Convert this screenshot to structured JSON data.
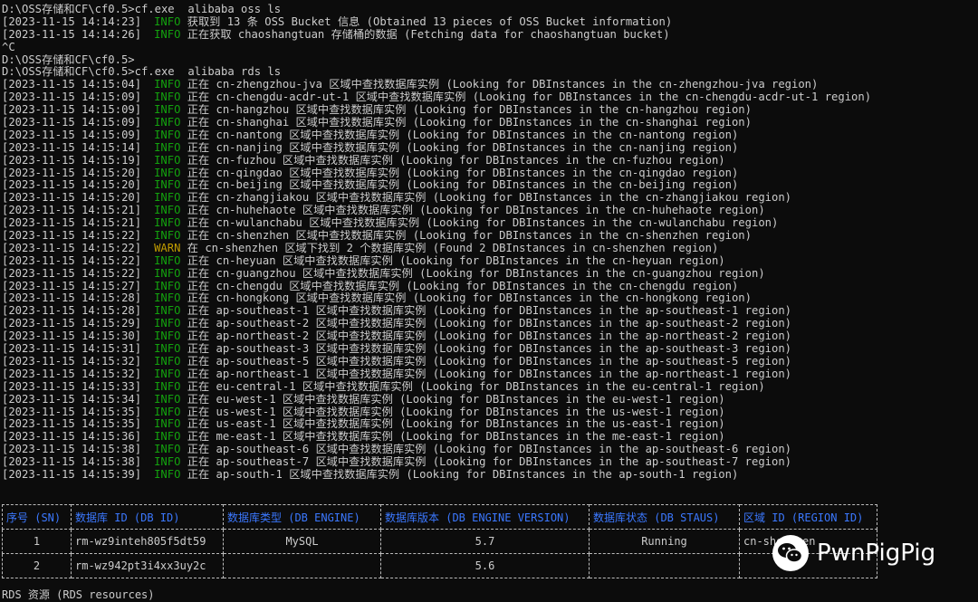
{
  "terminal": {
    "lines": [
      {
        "kind": "cmd",
        "text": "D:\\OSS存储和CF\\cf0.5>cf.exe  alibaba oss ls"
      },
      {
        "kind": "log",
        "ts": "[2023-11-15 14:14:23]",
        "level": "INFO",
        "msg": "获取到 13 条 OSS Bucket 信息 (Obtained 13 pieces of OSS Bucket information)"
      },
      {
        "kind": "log",
        "ts": "[2023-11-15 14:14:26]",
        "level": "INFO",
        "msg": "正在获取 chaoshangtuan 存储桶的数据 (Fetching data for chaoshangtuan bucket)"
      },
      {
        "kind": "cmd",
        "text": "^C"
      },
      {
        "kind": "cmd",
        "text": "D:\\OSS存储和CF\\cf0.5>"
      },
      {
        "kind": "cmd",
        "text": "D:\\OSS存储和CF\\cf0.5>cf.exe  alibaba rds ls"
      },
      {
        "kind": "log",
        "ts": "[2023-11-15 14:15:04]",
        "level": "INFO",
        "msg": "正在 cn-zhengzhou-jva 区域中查找数据库实例 (Looking for DBInstances in the cn-zhengzhou-jva region)"
      },
      {
        "kind": "log",
        "ts": "[2023-11-15 14:15:09]",
        "level": "INFO",
        "msg": "正在 cn-chengdu-acdr-ut-1 区域中查找数据库实例 (Looking for DBInstances in the cn-chengdu-acdr-ut-1 region)"
      },
      {
        "kind": "log",
        "ts": "[2023-11-15 14:15:09]",
        "level": "INFO",
        "msg": "正在 cn-hangzhou 区域中查找数据库实例 (Looking for DBInstances in the cn-hangzhou region)"
      },
      {
        "kind": "log",
        "ts": "[2023-11-15 14:15:09]",
        "level": "INFO",
        "msg": "正在 cn-shanghai 区域中查找数据库实例 (Looking for DBInstances in the cn-shanghai region)"
      },
      {
        "kind": "log",
        "ts": "[2023-11-15 14:15:09]",
        "level": "INFO",
        "msg": "正在 cn-nantong 区域中查找数据库实例 (Looking for DBInstances in the cn-nantong region)"
      },
      {
        "kind": "log",
        "ts": "[2023-11-15 14:15:14]",
        "level": "INFO",
        "msg": "正在 cn-nanjing 区域中查找数据库实例 (Looking for DBInstances in the cn-nanjing region)"
      },
      {
        "kind": "log",
        "ts": "[2023-11-15 14:15:19]",
        "level": "INFO",
        "msg": "正在 cn-fuzhou 区域中查找数据库实例 (Looking for DBInstances in the cn-fuzhou region)"
      },
      {
        "kind": "log",
        "ts": "[2023-11-15 14:15:20]",
        "level": "INFO",
        "msg": "正在 cn-qingdao 区域中查找数据库实例 (Looking for DBInstances in the cn-qingdao region)"
      },
      {
        "kind": "log",
        "ts": "[2023-11-15 14:15:20]",
        "level": "INFO",
        "msg": "正在 cn-beijing 区域中查找数据库实例 (Looking for DBInstances in the cn-beijing region)"
      },
      {
        "kind": "log",
        "ts": "[2023-11-15 14:15:20]",
        "level": "INFO",
        "msg": "正在 cn-zhangjiakou 区域中查找数据库实例 (Looking for DBInstances in the cn-zhangjiakou region)"
      },
      {
        "kind": "log",
        "ts": "[2023-11-15 14:15:21]",
        "level": "INFO",
        "msg": "正在 cn-huhehaote 区域中查找数据库实例 (Looking for DBInstances in the cn-huhehaote region)"
      },
      {
        "kind": "log",
        "ts": "[2023-11-15 14:15:21]",
        "level": "INFO",
        "msg": "正在 cn-wulanchabu 区域中查找数据库实例 (Looking for DBInstances in the cn-wulanchabu region)"
      },
      {
        "kind": "log",
        "ts": "[2023-11-15 14:15:22]",
        "level": "INFO",
        "msg": "正在 cn-shenzhen 区域中查找数据库实例 (Looking for DBInstances in the cn-shenzhen region)"
      },
      {
        "kind": "log",
        "ts": "[2023-11-15 14:15:22]",
        "level": "WARN",
        "msg": "在 cn-shenzhen 区域下找到 2 个数据库实例 (Found 2 DBInstances in cn-shenzhen region)"
      },
      {
        "kind": "log",
        "ts": "[2023-11-15 14:15:22]",
        "level": "INFO",
        "msg": "正在 cn-heyuan 区域中查找数据库实例 (Looking for DBInstances in the cn-heyuan region)"
      },
      {
        "kind": "log",
        "ts": "[2023-11-15 14:15:22]",
        "level": "INFO",
        "msg": "正在 cn-guangzhou 区域中查找数据库实例 (Looking for DBInstances in the cn-guangzhou region)"
      },
      {
        "kind": "log",
        "ts": "[2023-11-15 14:15:27]",
        "level": "INFO",
        "msg": "正在 cn-chengdu 区域中查找数据库实例 (Looking for DBInstances in the cn-chengdu region)"
      },
      {
        "kind": "log",
        "ts": "[2023-11-15 14:15:28]",
        "level": "INFO",
        "msg": "正在 cn-hongkong 区域中查找数据库实例 (Looking for DBInstances in the cn-hongkong region)"
      },
      {
        "kind": "log",
        "ts": "[2023-11-15 14:15:28]",
        "level": "INFO",
        "msg": "正在 ap-southeast-1 区域中查找数据库实例 (Looking for DBInstances in the ap-southeast-1 region)"
      },
      {
        "kind": "log",
        "ts": "[2023-11-15 14:15:29]",
        "level": "INFO",
        "msg": "正在 ap-southeast-2 区域中查找数据库实例 (Looking for DBInstances in the ap-southeast-2 region)"
      },
      {
        "kind": "log",
        "ts": "[2023-11-15 14:15:30]",
        "level": "INFO",
        "msg": "正在 ap-northeast-2 区域中查找数据库实例 (Looking for DBInstances in the ap-northeast-2 region)"
      },
      {
        "kind": "log",
        "ts": "[2023-11-15 14:15:31]",
        "level": "INFO",
        "msg": "正在 ap-southeast-3 区域中查找数据库实例 (Looking for DBInstances in the ap-southeast-3 region)"
      },
      {
        "kind": "log",
        "ts": "[2023-11-15 14:15:32]",
        "level": "INFO",
        "msg": "正在 ap-southeast-5 区域中查找数据库实例 (Looking for DBInstances in the ap-southeast-5 region)"
      },
      {
        "kind": "log",
        "ts": "[2023-11-15 14:15:32]",
        "level": "INFO",
        "msg": "正在 ap-northeast-1 区域中查找数据库实例 (Looking for DBInstances in the ap-northeast-1 region)"
      },
      {
        "kind": "log",
        "ts": "[2023-11-15 14:15:33]",
        "level": "INFO",
        "msg": "正在 eu-central-1 区域中查找数据库实例 (Looking for DBInstances in the eu-central-1 region)"
      },
      {
        "kind": "log",
        "ts": "[2023-11-15 14:15:34]",
        "level": "INFO",
        "msg": "正在 eu-west-1 区域中查找数据库实例 (Looking for DBInstances in the eu-west-1 region)"
      },
      {
        "kind": "log",
        "ts": "[2023-11-15 14:15:35]",
        "level": "INFO",
        "msg": "正在 us-west-1 区域中查找数据库实例 (Looking for DBInstances in the us-west-1 region)"
      },
      {
        "kind": "log",
        "ts": "[2023-11-15 14:15:35]",
        "level": "INFO",
        "msg": "正在 us-east-1 区域中查找数据库实例 (Looking for DBInstances in the us-east-1 region)"
      },
      {
        "kind": "log",
        "ts": "[2023-11-15 14:15:36]",
        "level": "INFO",
        "msg": "正在 me-east-1 区域中查找数据库实例 (Looking for DBInstances in the me-east-1 region)"
      },
      {
        "kind": "log",
        "ts": "[2023-11-15 14:15:38]",
        "level": "INFO",
        "msg": "正在 ap-southeast-6 区域中查找数据库实例 (Looking for DBInstances in the ap-southeast-6 region)"
      },
      {
        "kind": "log",
        "ts": "[2023-11-15 14:15:38]",
        "level": "INFO",
        "msg": "正在 ap-southeast-7 区域中查找数据库实例 (Looking for DBInstances in the ap-southeast-7 region)"
      },
      {
        "kind": "log",
        "ts": "[2023-11-15 14:15:39]",
        "level": "INFO",
        "msg": "正在 ap-south-1 区域中查找数据库实例 (Looking for DBInstances in the ap-south-1 region)"
      }
    ]
  },
  "table": {
    "headers": [
      "序号 (SN)",
      "数据库 ID (DB ID)",
      "数据库类型 (DB ENGINE)",
      "数据库版本 (DB ENGINE VERSION)",
      "数据库状态 (DB STAUS)",
      "区域 ID (REGION ID)"
    ],
    "rows": [
      [
        "1",
        "rm-wz9inteh805f5dt59",
        "MySQL",
        "5.7",
        "Running",
        "cn-shenzhen"
      ],
      [
        "2",
        "rm-wz942pt3i4xx3uy2c",
        "",
        "5.6",
        "",
        ""
      ]
    ]
  },
  "footer": {
    "text": "RDS 资源 (RDS resources)"
  },
  "watermark": {
    "text": "PwnPigPig",
    "icon": "wechat-icon"
  },
  "colors": {
    "info": "#13a10e",
    "warn": "#c19c00",
    "header": "#3b78ff",
    "background": "#0c0c0c"
  }
}
